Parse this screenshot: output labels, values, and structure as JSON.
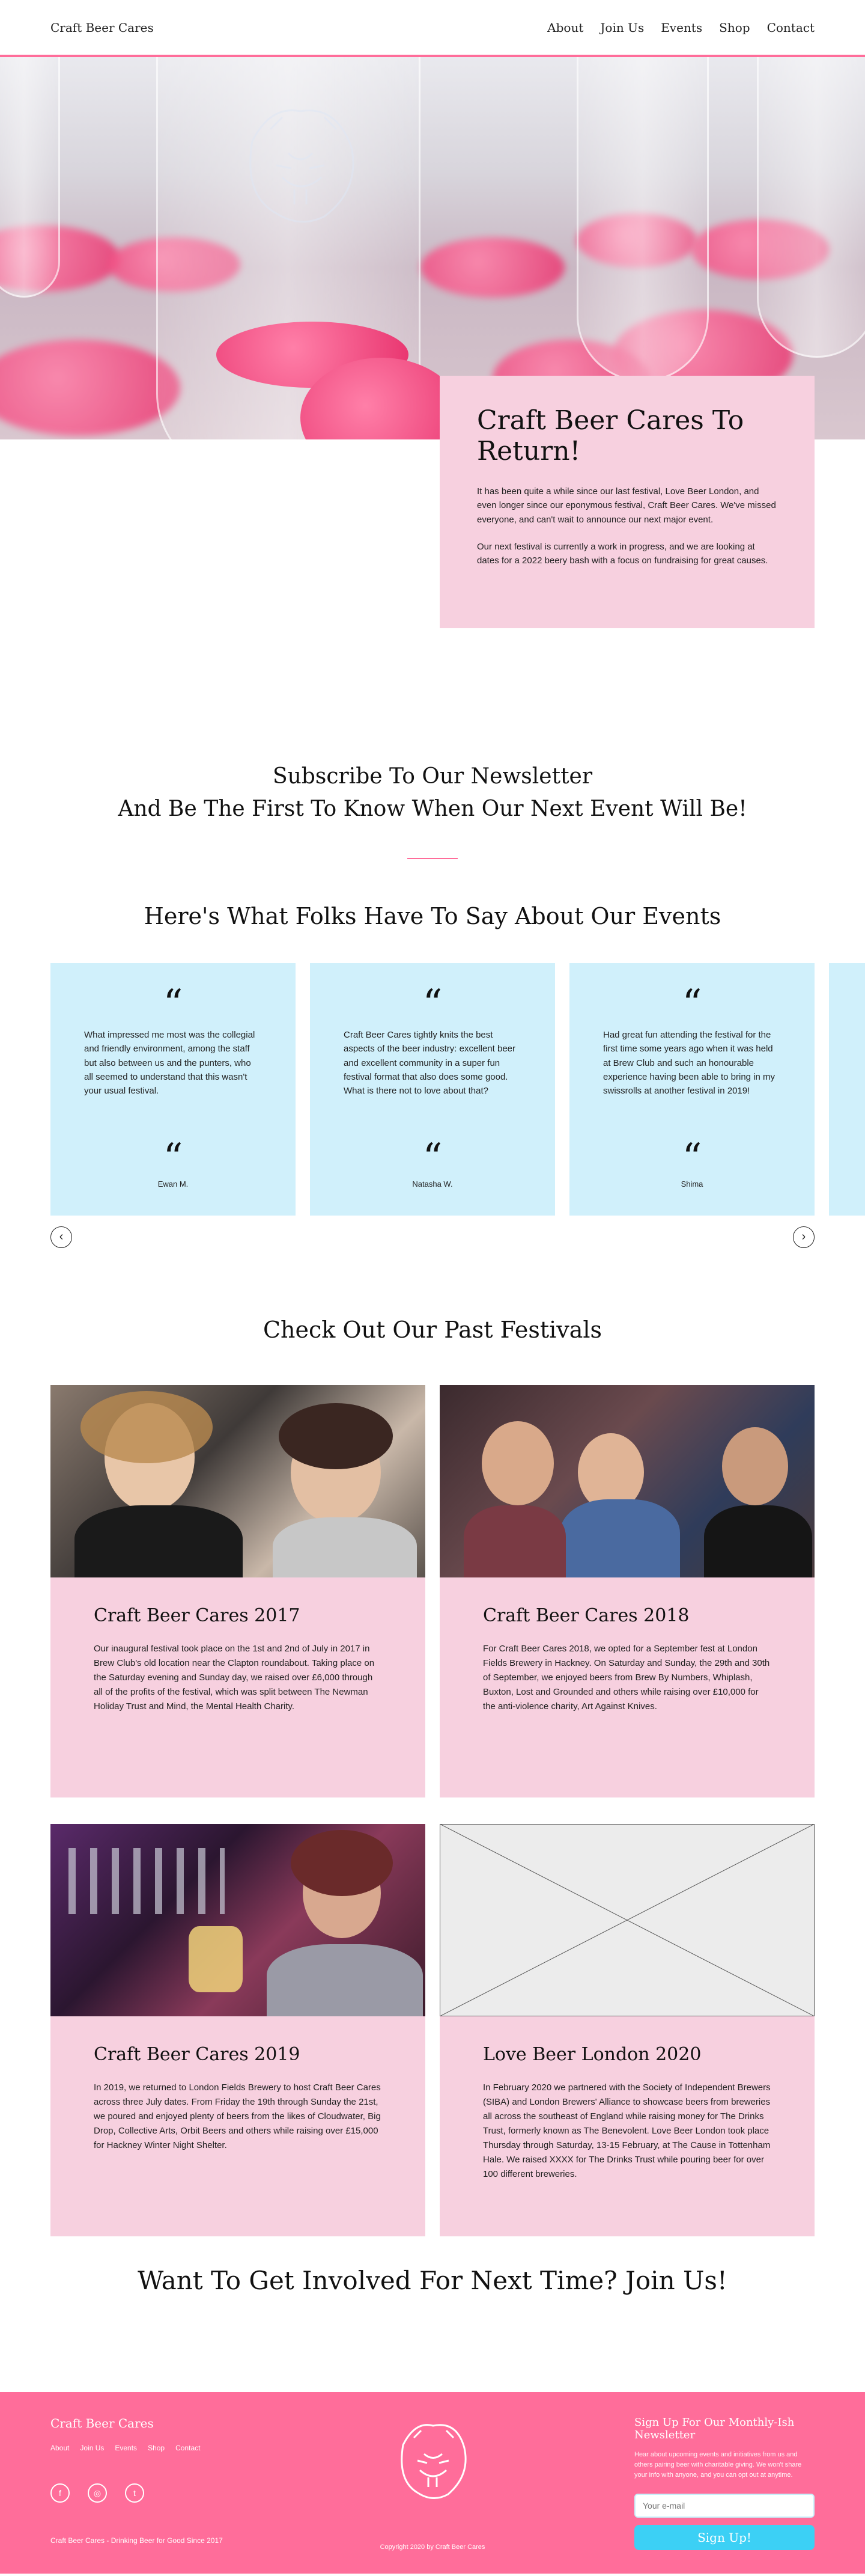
{
  "header": {
    "logo": "Craft Beer Cares",
    "nav": [
      "About",
      "Join Us",
      "Events",
      "Shop",
      "Contact"
    ]
  },
  "hero": {
    "title": "Craft Beer Cares To Return!",
    "p1": "It has been quite a while since our last festival, Love Beer London, and even longer since our eponymous festival, Craft Beer Cares. We've missed everyone, and can't wait to announce our next major event.",
    "p2": "Our next festival is currently a work in progress, and we are looking at dates for a 2022 beery bash with a focus on fundraising for great causes."
  },
  "newsletter": {
    "line1": "Subscribe To Our Newsletter",
    "line2": "And Be The First To Know When Our Next Event Will Be!"
  },
  "testimonials": {
    "heading": "Here's What Folks Have To Say About Our Events",
    "quote_mark": "“",
    "items": [
      {
        "text": "What impressed me most was the collegial and friendly environment, among the staff but also between us and the punters, who all seemed to understand that this wasn't your usual festival.",
        "name": "Ewan M."
      },
      {
        "text": "Craft Beer Cares tightly knits the best aspects of the beer industry: excellent beer and excellent community in a super fun festival format that also does some good. What is there not to love about that?",
        "name": "Natasha W."
      },
      {
        "text": "Had great fun attending the festival for the first time some years ago when it was held at Brew Club and such an honourable experience having been able to bring in my swissrolls at another festival in 2019!",
        "name": "Shima"
      }
    ],
    "prev_icon": "‹",
    "next_icon": "›"
  },
  "past": {
    "heading": "Check Out Our Past Festivals",
    "festivals": [
      {
        "title": "Craft Beer Cares 2017",
        "text": "Our inaugural festival took place on the 1st and 2nd of July in 2017 in Brew Club's old location near the Clapton roundabout. Taking place on the Saturday evening and Sunday day, we raised over £6,000 through all of the profits of the festival, which was split between The Newman Holiday Trust and Mind, the Mental Health Charity."
      },
      {
        "title": "Craft Beer Cares 2018",
        "text": "For Craft Beer Cares 2018, we opted for a September fest at London Fields Brewery in Hackney. On Saturday and Sunday, the 29th and 30th of September, we enjoyed beers from Brew By Numbers, Whiplash, Buxton, Lost and Grounded and others while raising over £10,000 for the anti-violence charity, Art Against Knives."
      },
      {
        "title": "Craft Beer Cares 2019",
        "text": "In 2019, we returned to London Fields Brewery to host Craft Beer Cares across three July dates. From Friday the 19th through Sunday the 21st, we poured and enjoyed plenty of beers from the likes of Cloudwater, Big Drop, Collective Arts, Orbit Beers and others while raising over £15,000 for Hackney Winter Night Shelter."
      },
      {
        "title": "Love Beer London 2020",
        "text": "In February 2020 we partnered with the Society of Independent Brewers (SIBA) and London Brewers' Alliance to showcase beers from breweries all across the southeast of England while raising money for The Drinks Trust, formerly known as The Benevolent. Love Beer London took place Thursday through Saturday, 13-15 February, at The Cause in Tottenham Hale. We raised XXXX for The Drinks Trust while pouring beer for over 100 different breweries."
      }
    ]
  },
  "join": {
    "heading": "Want To Get Involved For Next Time? Join Us!"
  },
  "footer": {
    "title": "Craft Beer Cares",
    "nav": [
      "About",
      "Join Us",
      "Events",
      "Shop",
      "Contact"
    ],
    "social": [
      "f",
      "◎",
      "t"
    ],
    "tagline": "Craft Beer Cares - Drinking Beer for Good Since 2017",
    "copyright": "Copyright 2020 by Craft Beer Cares",
    "news_title": "Sign Up For Our Monthly-Ish Newsletter",
    "news_text": "Hear about upcoming events and initiatives from us and others pairing beer with charitable giving. We won't share your info with anyone, and you can opt out at anytime.",
    "email_placeholder": "Your e-mail",
    "button": "Sign Up!"
  },
  "colors": {
    "accent_pink": "#ff6d9a",
    "card_pink": "#f7d0df",
    "card_blue": "#d0f0fb",
    "button_blue": "#3cd0f5"
  }
}
